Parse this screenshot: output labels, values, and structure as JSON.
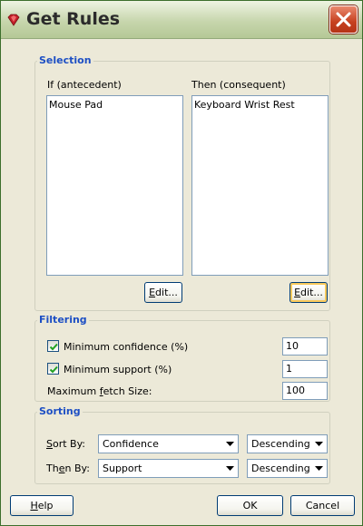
{
  "window": {
    "title": "Get Rules"
  },
  "selection": {
    "title": "Selection",
    "if_label": "If (antecedent)",
    "then_label": "Then (consequent)",
    "if_items": [
      "Mouse Pad"
    ],
    "then_items": [
      "Keyboard Wrist Rest"
    ],
    "edit_label": "Edit..."
  },
  "filtering": {
    "title": "Filtering",
    "min_confidence": {
      "label": "Minimum confidence (%)",
      "checked": true,
      "value": "10"
    },
    "min_support": {
      "label": "Minimum support (%)",
      "checked": true,
      "value": "1"
    },
    "max_fetch": {
      "label": "Maximum fetch Size:",
      "value": "100"
    }
  },
  "sorting": {
    "title": "Sorting",
    "sort_by_label": "Sort By:",
    "sort_by_value": "Confidence",
    "sort_by_order": "Descending",
    "then_by_label": "Then By:",
    "then_by_value": "Support",
    "then_by_order": "Descending"
  },
  "buttons": {
    "help": "Help",
    "ok": "OK",
    "cancel": "Cancel"
  },
  "colors": {
    "group_title": "#1d4fc4",
    "close_button": "#c6401f",
    "check": "#21a121"
  },
  "icons": {
    "app": "ruby-gem-icon",
    "close": "close-icon",
    "check": "checkmark-icon",
    "dropdown": "triangle-down-icon"
  }
}
